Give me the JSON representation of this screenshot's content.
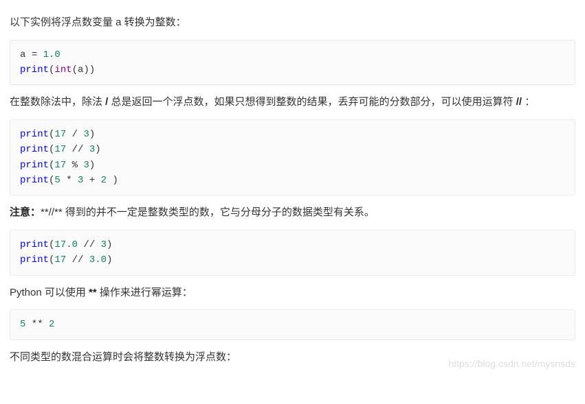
{
  "para1": "以下实例将浮点数变量 a 转换为整数：",
  "code1": {
    "line1_a": "a ",
    "line1_eq": "= ",
    "line1_v": "1.0",
    "line2_fn": "print",
    "line2_paren1": "(",
    "line2_int": "int",
    "line2_paren2": "(a))"
  },
  "para2_a": "在整数除法中，除法 ",
  "para2_b": "/",
  "para2_c": " 总是返回一个浮点数，如果只想得到整数的结果，丢弃可能的分数部分，可以使用运算符 ",
  "para2_d": "//",
  "para2_e": " ：",
  "code2": {
    "l1_p": "print",
    "l1_o": "(",
    "l1_n1": "17",
    "l1_m": " / ",
    "l1_n2": "3",
    "l1_c": ")",
    "l2_p": "print",
    "l2_o": "(",
    "l2_n1": "17",
    "l2_m": " // ",
    "l2_n2": "3",
    "l2_c": ")",
    "l3_p": "print",
    "l3_o": "(",
    "l3_n1": "17",
    "l3_m": " % ",
    "l3_n2": "3",
    "l3_c": ")",
    "l4_p": "print",
    "l4_o": "(",
    "l4_n1": "5",
    "l4_m1": " * ",
    "l4_n2": "3",
    "l4_m2": " + ",
    "l4_n3": "2",
    "l4_c": " )"
  },
  "para3_strong": "注意：",
  "para3_b1": "**",
  "para3_mid": "//",
  "para3_b2": "**",
  "para3_tail": " 得到的并不一定是整数类型的数，它与分母分子的数据类型有关系。",
  "code3": {
    "l1_p": "print",
    "l1_o": "(",
    "l1_n1": "17.0",
    "l1_m": " // ",
    "l1_n2": "3",
    "l1_c": ")",
    "l2_p": "print",
    "l2_o": "(",
    "l2_n1": "17",
    "l2_m": " // ",
    "l2_n2": "3.0",
    "l2_c": ")"
  },
  "para4_a": "Python 可以使用 ",
  "para4_b": "**",
  "para4_c": " 操作来进行幂运算：",
  "code4": {
    "n1": "5",
    "m": " ** ",
    "n2": "2"
  },
  "para5": "不同类型的数混合运算时会将整数转换为浮点数：",
  "watermark": "https://blog.csdn.net/mysnsds"
}
